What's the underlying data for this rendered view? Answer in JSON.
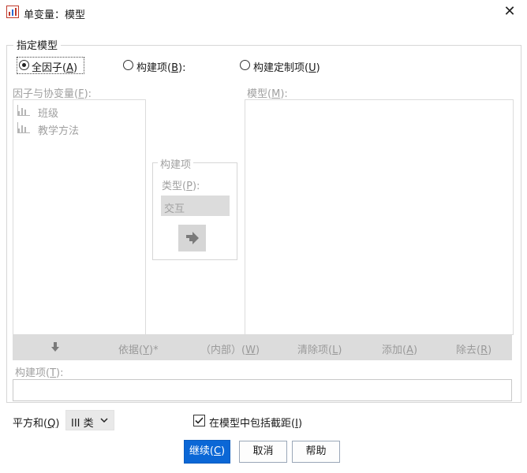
{
  "window": {
    "title": "单变量：模型",
    "close": "✕"
  },
  "spec": {
    "legend": "指定模型",
    "radios": [
      {
        "label": "全因子",
        "key": "A",
        "suffix": "",
        "checked": true
      },
      {
        "label": "构建项",
        "key": "B",
        "suffix": ":",
        "checked": false
      },
      {
        "label": "构建定制项",
        "key": "U",
        "suffix": "",
        "checked": false
      }
    ]
  },
  "factors": {
    "label": "因子与协变量",
    "key": "F",
    "suffix": ":",
    "items": [
      {
        "icon": "nominal-bar-chart-icon",
        "label": "班级"
      },
      {
        "icon": "nominal-bar-chart-icon",
        "label": "教学方法"
      }
    ]
  },
  "model": {
    "label": "模型",
    "key": "M",
    "suffix": ":"
  },
  "build": {
    "legend": "构建项",
    "type_label": "类型",
    "type_key": "P",
    "type_suffix": ":",
    "type_value": "交互",
    "arrow_icon": "right-arrow-icon"
  },
  "toolbar": {
    "down_icon": "down-arrow-icon",
    "by_label": "依据",
    "by_key": "Y",
    "by_suffix": ")*",
    "within_label": "（内部）",
    "within_key": "W",
    "clear_label": "清除项",
    "clear_key": "L",
    "add_label": "添加",
    "add_key": "A",
    "remove_label": "除去",
    "remove_key": "R"
  },
  "build_term": {
    "label": "构建项",
    "key": "T",
    "suffix": ":",
    "value": ""
  },
  "sum_of_squares": {
    "label": "平方和",
    "key": "Q",
    "value": "III 类"
  },
  "intercept": {
    "label": "在模型中包括截距",
    "key": "I",
    "checked": true
  },
  "buttons": {
    "continue_label": "继续",
    "continue_key": "C",
    "cancel_label": "取消",
    "help_label": "帮助"
  },
  "colors": {
    "accent": "#0b67d6",
    "disabled_text": "#a0a0a0",
    "toolbar_bg": "#dcdcdc"
  }
}
